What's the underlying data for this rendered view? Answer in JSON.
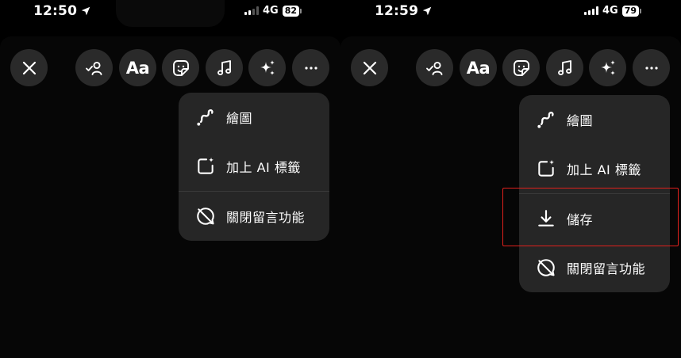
{
  "left": {
    "status": {
      "time": "12:50",
      "network": "4G",
      "battery": "82"
    },
    "menu": {
      "items": [
        {
          "label": "繪圖",
          "icon": "squiggle-draw-icon"
        },
        {
          "label": "加上 AI 標籤",
          "icon": "ai-label-icon"
        },
        {
          "label": "關閉留言功能",
          "icon": "comments-off-icon"
        }
      ]
    }
  },
  "right": {
    "status": {
      "time": "12:59",
      "network": "4G",
      "battery": "79"
    },
    "menu": {
      "items": [
        {
          "label": "繪圖",
          "icon": "squiggle-draw-icon"
        },
        {
          "label": "加上 AI 標籤",
          "icon": "ai-label-icon"
        },
        {
          "label": "儲存",
          "icon": "download-icon"
        },
        {
          "label": "關閉留言功能",
          "icon": "comments-off-icon"
        }
      ]
    }
  },
  "toolbar": {
    "text_tool_label": "Aa",
    "buttons": [
      "close-icon",
      "mention-people-icon",
      "text-tool",
      "sticker-icon",
      "music-icon",
      "effects-sparkle-icon",
      "more-icon"
    ]
  },
  "colors": {
    "background": "#000000",
    "button": "#2a2a2a",
    "menu": "#262626",
    "highlight": "#e0201c"
  }
}
